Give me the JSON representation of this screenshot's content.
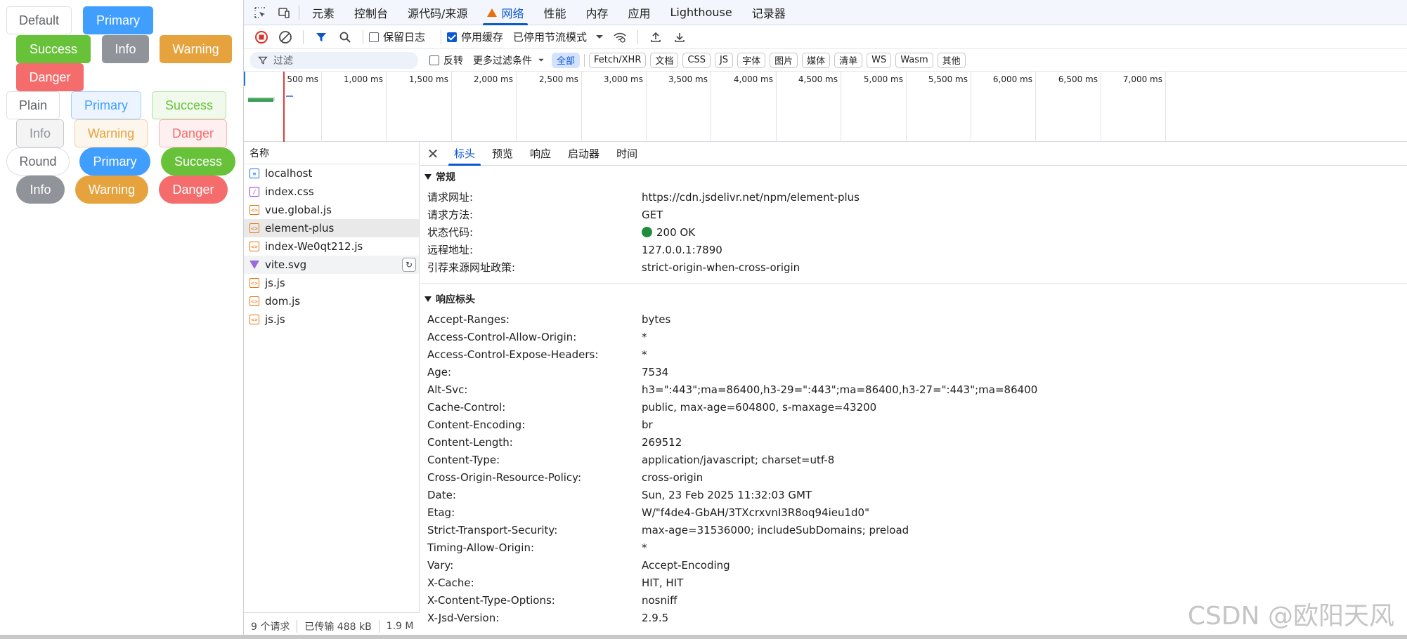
{
  "buttons": {
    "row1": [
      "Default",
      "Primary",
      "Success",
      "Info",
      "Warning",
      "Danger"
    ],
    "plain": [
      "Plain",
      "Primary",
      "Success",
      "Info",
      "Warning",
      "Danger"
    ],
    "round": [
      "Round",
      "Primary",
      "Success",
      "Info",
      "Warning",
      "Danger"
    ]
  },
  "devtools": {
    "tabs": [
      "元素",
      "控制台",
      "源代码/来源",
      "网络",
      "性能",
      "内存",
      "应用",
      "Lighthouse",
      "记录器"
    ],
    "active_tab": "网络",
    "toolbar": {
      "preserve_log": "保留日志",
      "disable_cache": "停用缓存",
      "throttling": "已停用节流模式"
    },
    "filter": {
      "placeholder": "过滤",
      "invert": "反转",
      "more_filters": "更多过滤条件",
      "types": [
        "全部",
        "Fetch/XHR",
        "文档",
        "CSS",
        "JS",
        "字体",
        "图片",
        "媒体",
        "清单",
        "WS",
        "Wasm",
        "其他"
      ]
    },
    "timeline_ticks": [
      "500 ms",
      "1,000 ms",
      "1,500 ms",
      "2,000 ms",
      "2,500 ms",
      "3,000 ms",
      "3,500 ms",
      "4,000 ms",
      "4,500 ms",
      "5,000 ms",
      "5,500 ms",
      "6,000 ms",
      "6,500 ms",
      "7,000 ms"
    ],
    "requests": {
      "header": "名称",
      "items": [
        {
          "name": "localhost",
          "type": "doc"
        },
        {
          "name": "index.css",
          "type": "css"
        },
        {
          "name": "vue.global.js",
          "type": "js"
        },
        {
          "name": "element-plus",
          "type": "js"
        },
        {
          "name": "index-We0qt212.js",
          "type": "js"
        },
        {
          "name": "vite.svg",
          "type": "svg"
        },
        {
          "name": "js.js",
          "type": "js"
        },
        {
          "name": "dom.js",
          "type": "js"
        },
        {
          "name": "js.js",
          "type": "js"
        }
      ],
      "status": {
        "count": "9 个请求",
        "transferred": "已传输 488 kB",
        "resources": "1.9 M"
      }
    },
    "detail": {
      "tabs": [
        "标头",
        "预览",
        "响应",
        "启动器",
        "时间"
      ],
      "general_title": "常规",
      "general": [
        {
          "k": "请求网址:",
          "v": "https://cdn.jsdelivr.net/npm/element-plus"
        },
        {
          "k": "请求方法:",
          "v": "GET"
        },
        {
          "k": "状态代码:",
          "v": "200 OK"
        },
        {
          "k": "远程地址:",
          "v": "127.0.0.1:7890"
        },
        {
          "k": "引荐来源网址政策:",
          "v": "strict-origin-when-cross-origin"
        }
      ],
      "response_title": "响应标头",
      "response": [
        {
          "k": "Accept-Ranges:",
          "v": "bytes"
        },
        {
          "k": "Access-Control-Allow-Origin:",
          "v": "*"
        },
        {
          "k": "Access-Control-Expose-Headers:",
          "v": "*"
        },
        {
          "k": "Age:",
          "v": "7534"
        },
        {
          "k": "Alt-Svc:",
          "v": "h3=\":443\";ma=86400,h3-29=\":443\";ma=86400,h3-27=\":443\";ma=86400"
        },
        {
          "k": "Cache-Control:",
          "v": "public, max-age=604800, s-maxage=43200"
        },
        {
          "k": "Content-Encoding:",
          "v": "br"
        },
        {
          "k": "Content-Length:",
          "v": "269512"
        },
        {
          "k": "Content-Type:",
          "v": "application/javascript; charset=utf-8"
        },
        {
          "k": "Cross-Origin-Resource-Policy:",
          "v": "cross-origin"
        },
        {
          "k": "Date:",
          "v": "Sun, 23 Feb 2025 11:32:03 GMT"
        },
        {
          "k": "Etag:",
          "v": "W/\"f4de4-GbAH/3TXcrxvnI3R8oq94ieu1d0\""
        },
        {
          "k": "Strict-Transport-Security:",
          "v": "max-age=31536000; includeSubDomains; preload"
        },
        {
          "k": "Timing-Allow-Origin:",
          "v": "*"
        },
        {
          "k": "Vary:",
          "v": "Accept-Encoding"
        },
        {
          "k": "X-Cache:",
          "v": "HIT, HIT"
        },
        {
          "k": "X-Content-Type-Options:",
          "v": "nosniff"
        },
        {
          "k": "X-Jsd-Version:",
          "v": "2.9.5"
        }
      ]
    }
  },
  "watermark": "CSDN @欧阳天风",
  "colors": {
    "primary": "#409eff",
    "success": "#67c23a",
    "info": "#909399",
    "warning": "#e6a23c",
    "danger": "#f56c6c",
    "devtools_accent": "#0b57d0",
    "status_ok": "#1e8e3e"
  }
}
